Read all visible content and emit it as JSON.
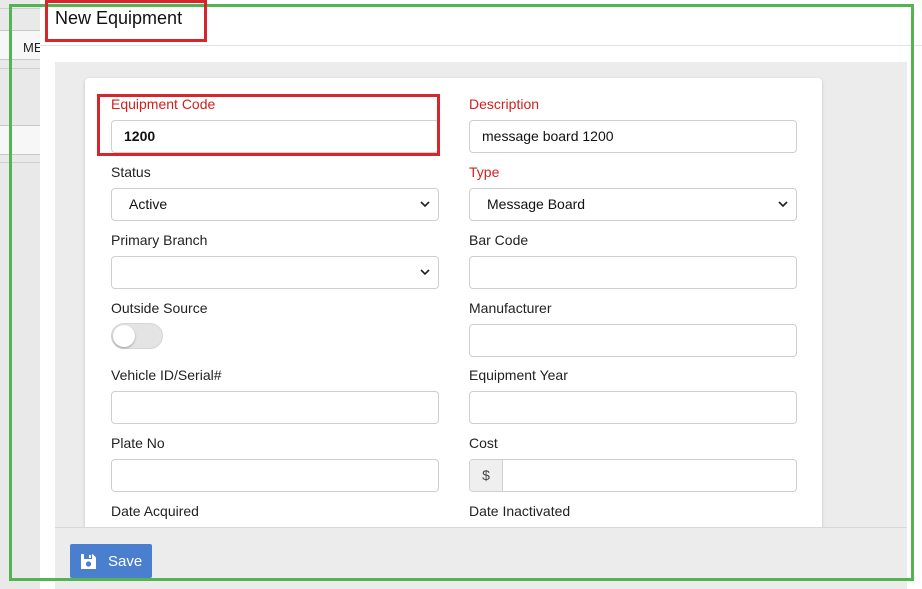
{
  "background": {
    "partial_text": "ME"
  },
  "modal": {
    "title": "New Equipment"
  },
  "form": {
    "equipment_code": {
      "label": "Equipment Code",
      "value": "1200",
      "required": true
    },
    "description": {
      "label": "Description",
      "value": "message board 1200",
      "required": true
    },
    "status": {
      "label": "Status",
      "value": "Active"
    },
    "type": {
      "label": "Type",
      "value": "Message Board",
      "required": true
    },
    "primary_branch": {
      "label": "Primary Branch",
      "value": ""
    },
    "bar_code": {
      "label": "Bar Code",
      "value": ""
    },
    "outside_source": {
      "label": "Outside Source",
      "on": false
    },
    "manufacturer": {
      "label": "Manufacturer",
      "value": ""
    },
    "vehicle_id": {
      "label": "Vehicle ID/Serial#",
      "value": ""
    },
    "equipment_year": {
      "label": "Equipment Year",
      "value": ""
    },
    "plate_no": {
      "label": "Plate No",
      "value": ""
    },
    "cost": {
      "label": "Cost",
      "prefix": "$",
      "value": ""
    },
    "date_acquired": {
      "label": "Date Acquired",
      "value": ""
    },
    "date_inactivated": {
      "label": "Date Inactivated",
      "value": ""
    }
  },
  "footer": {
    "save_label": "Save"
  },
  "icons": {
    "save": "floppy-disk-icon",
    "dropdown": "chevron-down-icon"
  },
  "colors": {
    "required_label": "#d21f1f",
    "save_button": "#4a7fd0",
    "annotation_green": "#53b552",
    "annotation_red": "#d7262b"
  }
}
